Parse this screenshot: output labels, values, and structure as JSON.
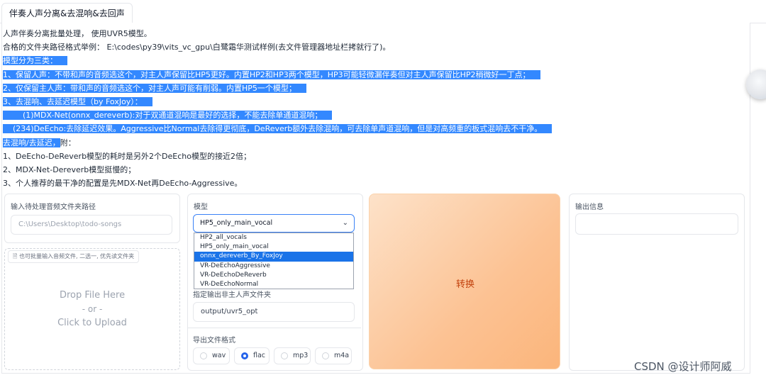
{
  "tab": {
    "label": "伴奏人声分离&去混响&去回声"
  },
  "description": {
    "lines": [
      "人声伴奏分离批量处理， 使用UVR5模型。",
      "合格的文件夹路径格式举例： E:\\codes\\py39\\vits_vc_gpu\\白鹭霜华测试样例(去文件管理器地址栏拷就行了)。",
      "模型分为三类：",
      "1、保留人声：不带和声的音频选这个，对主人声保留比HP5更好。内置HP2和HP3两个模型，HP3可能轻微漏伴奏但对主人声保留比HP2稍微好一丁点；",
      "2、仅保留主人声：带和声的音频选这个，对主人声可能有削弱。内置HP5一个模型；",
      "3、去混响、去延迟模型（by FoxJoy）：",
      "        (1)MDX-Net(onnx_dereverb):对于双通道混响是最好的选择，不能去除单通道混响；",
      "    (234)DeEcho:去除延迟效果。Aggressive比Normal去除得更彻底，DeReverb额外去除混响，可去除单声道混响，但是对高频重的板式混响去不干净。",
      "去混响/去延迟，",
      "附：",
      "1、DeEcho-DeReverb模型的耗时是另外2个DeEcho模型的接近2倍；",
      "2、MDX-Net-Dereverb模型挺慢的；",
      "3、个人推荐的最干净的配置是先MDX-Net再DeEcho-Aggressive。"
    ]
  },
  "input_folder": {
    "label": "输入待处理音频文件夹路径",
    "placeholder": "C:\\Users\\Desktop\\todo-songs"
  },
  "upload": {
    "note": "也可批量输入音频文件, 二选一, 优先读文件夹",
    "drop": "Drop File Here",
    "or": "- or -",
    "click": "Click to Upload"
  },
  "model": {
    "label": "模型",
    "selected": "HP5_only_main_vocal",
    "options": [
      "HP2_all_vocals",
      "HP5_only_main_vocal",
      "onnx_dereverb_By_FoxJoy",
      "VR-DeEchoAggressive",
      "VR-DeEchoDeReverb",
      "VR-DeEchoNormal"
    ],
    "highlighted_option": "onnx_dereverb_By_FoxJoy"
  },
  "output_instrumental": {
    "label": "指定输出非主人声文件夹",
    "value": "output/uvr5_opt"
  },
  "export_format": {
    "label": "导出文件格式",
    "options": [
      "wav",
      "flac",
      "mp3",
      "m4a"
    ],
    "selected": "flac"
  },
  "convert": {
    "label": "转换",
    "accent": "#fbb57b"
  },
  "output_info": {
    "label": "输出信息",
    "value": ""
  },
  "watermark": "CSDN @设计师阿威"
}
